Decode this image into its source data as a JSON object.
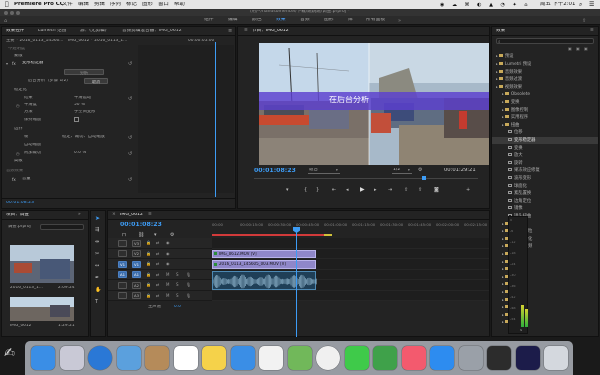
{
  "menubar": {
    "app": "Premiere Pro CC",
    "menus": [
      "文件",
      "编辑",
      "剪辑",
      "序列",
      "标记",
      "图形",
      "窗口",
      "帮助"
    ],
    "clock": "周五 下午2:01"
  },
  "workspaces": [
    "组件",
    "编辑",
    "颜色",
    "效果",
    "音频",
    "图形",
    "库",
    "所有面板"
  ],
  "active_workspace": "效果",
  "project_path": "/用户/handsomericel/下载/跳跳跳/调查.prproj *",
  "effect_controls": {
    "tabs": [
      "效果控件",
      "Lumetri 范围",
      "源：(无剪辑)",
      "音频剪辑混合器：IMG_0612"
    ],
    "source_name": "主要 * 2016_0113_14560...",
    "clip_name": "IMG_0612 * 2016_0113_1...",
    "ruler_time": "00:00:05:00",
    "rows": {
      "opacity": "不透明度",
      "mask": "蒙版",
      "transform": "变形稳定器",
      "analyze_btn": "分析",
      "cancel_btn": "取消",
      "status": "后台分析（步骤 1/2）",
      "stabilize": "稳定化",
      "result": "结果",
      "result_val": "平滑运动",
      "smooth": "平滑度",
      "smooth_val": "50 %",
      "method": "方法",
      "method_val": "子空间变形",
      "keep_scale": "保持缩放",
      "borders": "边界",
      "framing": "帧",
      "framing_val": "稳定、裁切、自动缩放",
      "auto_scale": "自动缩放",
      "extra_crop": "附加裁切",
      "extra_val": "0.0 %",
      "advanced": "高级",
      "audio_effects": "音频效果",
      "volume": "音量"
    },
    "footer_time": "00:01:08:23"
  },
  "program": {
    "title": "节目：IMG_0612",
    "overlay_text": "在后台分析",
    "timecode": "00:01:08:23",
    "fit": "适合",
    "quality": "1/2",
    "duration": "00:01:29:21"
  },
  "effects": {
    "title": "效果",
    "search_placeholder": "",
    "items": [
      {
        "label": "预设",
        "type": "folder",
        "indent": 0
      },
      {
        "label": "Lumetri 预设",
        "type": "folder",
        "indent": 0
      },
      {
        "label": "音频效果",
        "type": "folder",
        "indent": 0
      },
      {
        "label": "音频过渡",
        "type": "folder",
        "indent": 0
      },
      {
        "label": "视频效果",
        "type": "folder",
        "indent": 0
      },
      {
        "label": "Obsolete",
        "type": "folder",
        "indent": 1
      },
      {
        "label": "变换",
        "type": "folder",
        "indent": 1
      },
      {
        "label": "图像控制",
        "type": "folder",
        "indent": 1
      },
      {
        "label": "实用程序",
        "type": "folder",
        "indent": 1
      },
      {
        "label": "扭曲",
        "type": "folder",
        "indent": 1
      },
      {
        "label": "位移",
        "type": "fx",
        "indent": 2
      },
      {
        "label": "变形稳定器",
        "type": "fx",
        "indent": 2,
        "selected": true
      },
      {
        "label": "变换",
        "type": "fx",
        "indent": 2
      },
      {
        "label": "放大",
        "type": "fx",
        "indent": 2
      },
      {
        "label": "旋转",
        "type": "fx",
        "indent": 2
      },
      {
        "label": "果冻效应修复",
        "type": "fx",
        "indent": 2
      },
      {
        "label": "波形变形",
        "type": "fx",
        "indent": 2
      },
      {
        "label": "球面化",
        "type": "fx",
        "indent": 2
      },
      {
        "label": "紊乱置换",
        "type": "fx",
        "indent": 2
      },
      {
        "label": "边角定位",
        "type": "fx",
        "indent": 2
      },
      {
        "label": "镜像",
        "type": "fx",
        "indent": 2
      },
      {
        "label": "镜头扭曲",
        "type": "fx",
        "indent": 2
      },
      {
        "label": "时间",
        "type": "folder",
        "indent": 1
      },
      {
        "label": "杂色与颗粒",
        "type": "folder",
        "indent": 1
      },
      {
        "label": "模糊与锐化",
        "type": "folder",
        "indent": 1
      },
      {
        "label": "沉浸式视频",
        "type": "folder",
        "indent": 1
      },
      {
        "label": "生成",
        "type": "folder",
        "indent": 1
      },
      {
        "label": "视频",
        "type": "folder",
        "indent": 1
      },
      {
        "label": "调整",
        "type": "folder",
        "indent": 1
      },
      {
        "label": "过时",
        "type": "folder",
        "indent": 1
      },
      {
        "label": "过渡",
        "type": "folder",
        "indent": 1
      },
      {
        "label": "透视",
        "type": "folder",
        "indent": 1
      },
      {
        "label": "通道",
        "type": "folder",
        "indent": 1
      },
      {
        "label": "键控",
        "type": "folder",
        "indent": 1
      },
      {
        "label": "颜色校正",
        "type": "folder",
        "indent": 1
      },
      {
        "label": "风格化",
        "type": "folder",
        "indent": 1
      }
    ]
  },
  "project": {
    "title": "项目：调查",
    "file": "调查.prproj",
    "thumb1_name": "2016_0113_1...",
    "thumb1_dur": "2:09:24",
    "thumb2_name": "IMG_0612",
    "thumb2_dur": "1:29:21"
  },
  "timeline": {
    "title": "IMG_0612",
    "timecode": "00:01:08:23",
    "ruler": [
      "00:00",
      "00:00:15:00",
      "00:00:30:00",
      "00:00:45:00",
      "00:01:00:00",
      "00:01:15:00",
      "00:01:30:00",
      "00:01:45:00",
      "00:02:00:00",
      "00:02:15:00"
    ],
    "video_tracks": [
      "V3",
      "V2",
      "V1"
    ],
    "audio_tracks": [
      "A1",
      "A2",
      "A3"
    ],
    "clip_v2": "IMG_0612.MOV [V]",
    "clip_v1": "2016_0113_145605_003.MOV [V]",
    "master": "主声道",
    "master_val": "0.0"
  },
  "audio_meter": {
    "labels": [
      "0",
      "-6",
      "-12",
      "-18",
      "-24",
      "-30",
      "-36",
      "-42",
      "-48",
      "-54"
    ],
    "solo": "S"
  },
  "colors": {
    "accent": "#3d9cf5",
    "video_clip": "#8f87c9",
    "audio_clip": "#4d8a8f",
    "render_bar": "#d23a3a"
  }
}
